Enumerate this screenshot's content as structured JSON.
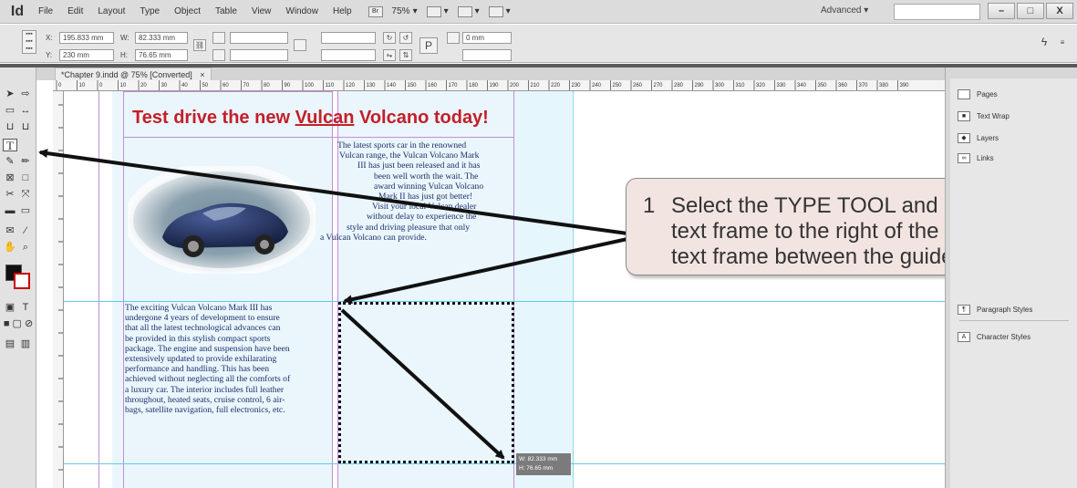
{
  "app": {
    "logo": "Id",
    "menus": [
      "File",
      "Edit",
      "Layout",
      "Type",
      "Object",
      "Table",
      "View",
      "Window",
      "Help"
    ],
    "zoom": "75%",
    "workspace": "Advanced",
    "window_buttons": [
      "–",
      "□",
      "X"
    ]
  },
  "control_panel": {
    "x_label": "X:",
    "x_value": "195.833 mm",
    "y_label": "Y:",
    "y_value": "230 mm",
    "w_label": "W:",
    "w_value": "82.333 mm",
    "h_label": "H:",
    "h_value": "76.65 mm",
    "stroke_value": "0 mm"
  },
  "document": {
    "tab_title": "*Chapter 9.indd @ 75% [Converted]",
    "tab_close": "×"
  },
  "ruler_h_labels": [
    "0",
    "10",
    "0",
    "10",
    "20",
    "30",
    "40",
    "50",
    "60",
    "70",
    "80",
    "90",
    "100",
    "110",
    "120",
    "130",
    "140",
    "150",
    "160",
    "170",
    "180",
    "190",
    "200",
    "210",
    "220",
    "230",
    "240",
    "250",
    "260",
    "270",
    "280",
    "290",
    "300",
    "310",
    "320",
    "330",
    "340",
    "350",
    "360",
    "370",
    "380",
    "390"
  ],
  "page": {
    "headline_pre": "Test drive the new ",
    "headline_word": "Vulcan",
    "headline_post": " Volcano today!",
    "p1_lines": [
      "The latest sports car in the renowned",
      "Vulcan range, the Vulcan Volcano Mark",
      "III has just been released and it has",
      "been well worth the wait.  The",
      "award winning Vulcan Volcano",
      "Mark II has just got better!",
      "Visit your local Vulcan dealer",
      "without delay to experience the",
      "style and driving pleasure that only",
      "a Vulcan Volcano can provide."
    ],
    "p2_lines": [
      "The exciting Vulcan Volcano Mark III has",
      "undergone 4 years of development to ensure",
      "that all the latest technological advances can",
      "be provided in this stylish compact sports",
      "package. The engine and suspension have been",
      "extensively updated to provide exhilarating",
      "performance and handling.  This has been",
      "achieved without neglecting all the comforts of",
      "a luxury car.  The interior includes full leather",
      "throughout, heated seats, cruise control, 6 air-",
      "bags, satellite navigation, full electronics, etc."
    ]
  },
  "size_tooltip": {
    "w": "W: 82.333 mm",
    "h": "H: 76.65 mm"
  },
  "callout": {
    "number": "1",
    "lines": [
      "Select the TYPE TOOL and drag",
      "text frame to the right of the se",
      "text frame between the guide"
    ]
  },
  "panels": [
    "Pages",
    "Text Wrap",
    "Layers",
    "Links",
    "Paragraph Styles",
    "Character Styles"
  ],
  "colors": {
    "headline": "#c41e2a",
    "body_text": "#1c2d6b",
    "guide": "#5ccde8",
    "margin": "#c58dd6",
    "callout_bg": "#f2e4e1"
  },
  "icons": {
    "type_tool": "T",
    "selection": "arrow-icon",
    "hand": "hand-icon",
    "zoom": "magnifier-icon"
  }
}
